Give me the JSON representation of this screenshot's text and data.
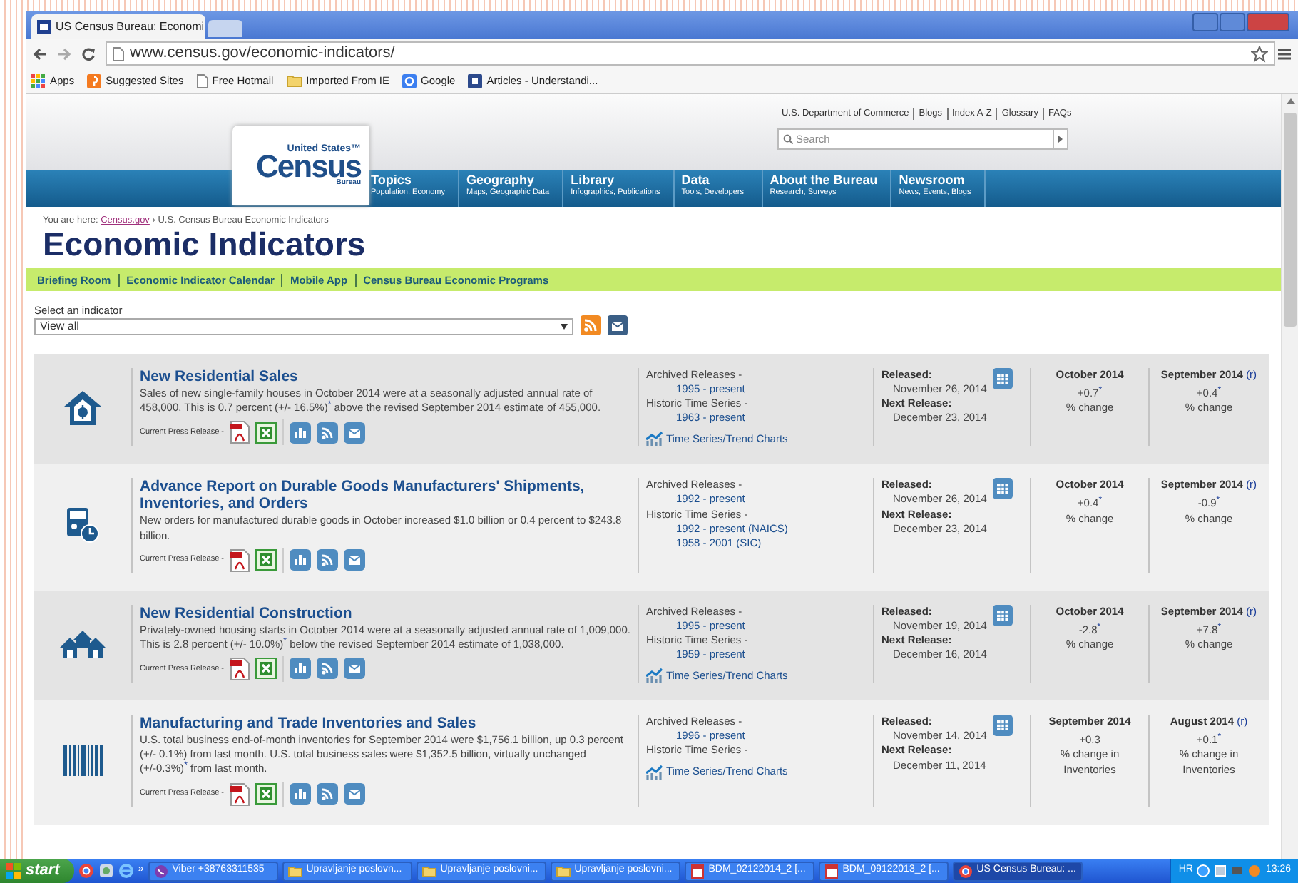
{
  "browser": {
    "tabs": [
      {
        "title": "US Census Bureau: Economi",
        "selected": true
      }
    ],
    "url": "www.census.gov/economic-indicators/",
    "bookmarks": [
      {
        "kind": "grid",
        "label": "Apps"
      },
      {
        "kind": "pin",
        "label": "Suggested Sites"
      },
      {
        "kind": "page",
        "label": "Free Hotmail"
      },
      {
        "kind": "folder",
        "label": "Imported From IE"
      },
      {
        "kind": "blue",
        "label": "Google"
      },
      {
        "kind": "navy",
        "label": "Articles - Understandi..."
      }
    ]
  },
  "header": {
    "gov_links": [
      "U.S. Department of Commerce",
      "Blogs",
      "Index A-Z",
      "Glossary",
      "FAQs"
    ],
    "search": {
      "placeholder": "Search"
    },
    "logo": {
      "top": "United States™",
      "main": "Census",
      "bottom": "Bureau"
    },
    "nav": [
      {
        "title": "Topics",
        "sub": "Population, Economy"
      },
      {
        "title": "Geography",
        "sub": "Maps, Geographic Data"
      },
      {
        "title": "Library",
        "sub": "Infographics, Publications"
      },
      {
        "title": "Data",
        "sub": "Tools, Developers"
      },
      {
        "title": "About the Bureau",
        "sub": "Research, Surveys"
      },
      {
        "title": "Newsroom",
        "sub": "News, Events, Blogs"
      }
    ]
  },
  "breadcrumb": {
    "label": "You are here:",
    "separator": "›",
    "links": [
      "Census.gov",
      "U.S. Census Bureau Economic Indicators"
    ]
  },
  "title": "Economic Indicators",
  "subnav": [
    "Briefing Room",
    "Economic Indicator Calendar",
    "Mobile App",
    "Census Bureau Economic Programs"
  ],
  "selector": {
    "label": "Select an indicator",
    "value": "View all"
  },
  "indicators": [
    {
      "kind": "house",
      "title": "New Residential Sales",
      "description": "Sales of new single-family houses in October 2014 were at a seasonally adjusted annual rate of 458,000. This is 0.7 percent (+/- 16.5%)$^{*}$ above the revised September 2014 estimate of 455,000.",
      "press_label": "Current Press Release -",
      "archived_label": "Archived Releases -",
      "archived": [
        "1995 - present"
      ],
      "historic_label": "Historic Time Series -",
      "historic": [
        "1963 - present"
      ],
      "trend_link": "Time Series/Trend Charts",
      "released_label": "Released:",
      "released": "November 26, 2014",
      "next_label": "Next Release:",
      "next": "December 23, 2014",
      "periods": [
        {
          "heading": "October 2014",
          "value": "+0.7$^{*}$",
          "unit": "% change"
        },
        {
          "heading": "September 2014",
          "revised": "(r)",
          "value": "+0.4$^{*}$",
          "unit": "% change"
        }
      ]
    },
    {
      "kind": "device",
      "title": "Advance Report on Durable Goods Manufacturers' Shipments, Inventories, and Orders",
      "description": "New orders for manufactured durable goods in October increased $1.0 billion or 0.4 percent to $243.8 billion.",
      "press_label": "Current Press Release -",
      "archived_label": "Archived Releases -",
      "archived": [
        "1992 - present"
      ],
      "historic_label": "Historic Time Series -",
      "historic": [
        "1992 - present (NAICS)",
        "1958 - 2001 (SIC)"
      ],
      "released_label": "Released:",
      "released": "November 26, 2014",
      "next_label": "Next Release:",
      "next": "December 23, 2014",
      "periods": [
        {
          "heading": "October 2014",
          "value": "+0.4$^{*}$",
          "unit": "% change"
        },
        {
          "heading": "September 2014",
          "revised": "(r)",
          "value": "-0.9$^{*}$",
          "unit": "% change"
        }
      ]
    },
    {
      "kind": "houses",
      "title": "New Residential Construction",
      "description": "Privately-owned housing starts in October 2014 were at a seasonally adjusted annual rate of 1,009,000. This is 2.8 percent (+/- 10.0%)$^{*}$ below the revised September 2014 estimate of 1,038,000.",
      "press_label": "Current Press Release -",
      "archived_label": "Archived Releases -",
      "archived": [
        "1995 - present"
      ],
      "historic_label": "Historic Time Series -",
      "historic": [
        "1959 - present"
      ],
      "trend_link": "Time Series/Trend Charts",
      "released_label": "Released:",
      "released": "November 19, 2014",
      "next_label": "Next Release:",
      "next": "December 16, 2014",
      "periods": [
        {
          "heading": "October 2014",
          "value": "-2.8$^{*}$",
          "unit": "% change"
        },
        {
          "heading": "September 2014",
          "revised": "(r)",
          "value": "+7.8$^{*}$",
          "unit": "% change"
        }
      ]
    },
    {
      "kind": "barcode",
      "title": "Manufacturing and Trade Inventories and Sales",
      "description": "U.S. total business end-of-month inventories for September 2014 were $1,756.1 billion, up 0.3 percent (+/- 0.1%) from last month. U.S. total business sales were $1,352.5 billion, virtually unchanged (+/-0.3%)$^{*}$ from last month.",
      "press_label": "Current Press Release -",
      "archived_label": "Archived Releases -",
      "archived": [
        "1996 - present"
      ],
      "historic_label": "Historic Time Series -",
      "trend_link": "Time Series/Trend Charts",
      "released_label": "Released:",
      "released": "November 14, 2014",
      "next_label": "Next Release:",
      "next": "December 11, 2014",
      "periods": [
        {
          "heading": "September 2014",
          "value": "+0.3",
          "unit": "% change in Inventories"
        },
        {
          "heading": "August 2014",
          "revised": "(r)",
          "value": "+0.1$^{*}$",
          "unit": "% change in Inventories"
        }
      ]
    }
  ],
  "taskbar": {
    "start": "start",
    "more": "»",
    "tasks": [
      {
        "kind": "viber",
        "label": "Viber +38763311535",
        "selected": false
      },
      {
        "kind": "folder",
        "label": "Upravljanje poslovn...",
        "selected": false
      },
      {
        "kind": "folder",
        "label": "Upravljanje poslovni...",
        "selected": false
      },
      {
        "kind": "folder",
        "label": "Upravljanje poslovni...",
        "selected": false
      },
      {
        "kind": "doc",
        "label": "BDM_02122014_2 [...",
        "selected": false
      },
      {
        "kind": "doc",
        "label": "BDM_09122013_2 [...",
        "selected": false
      },
      {
        "kind": "browser",
        "label": "US Census Bureau: ...",
        "selected": true
      }
    ],
    "language": "HR",
    "clock": "13:26"
  }
}
